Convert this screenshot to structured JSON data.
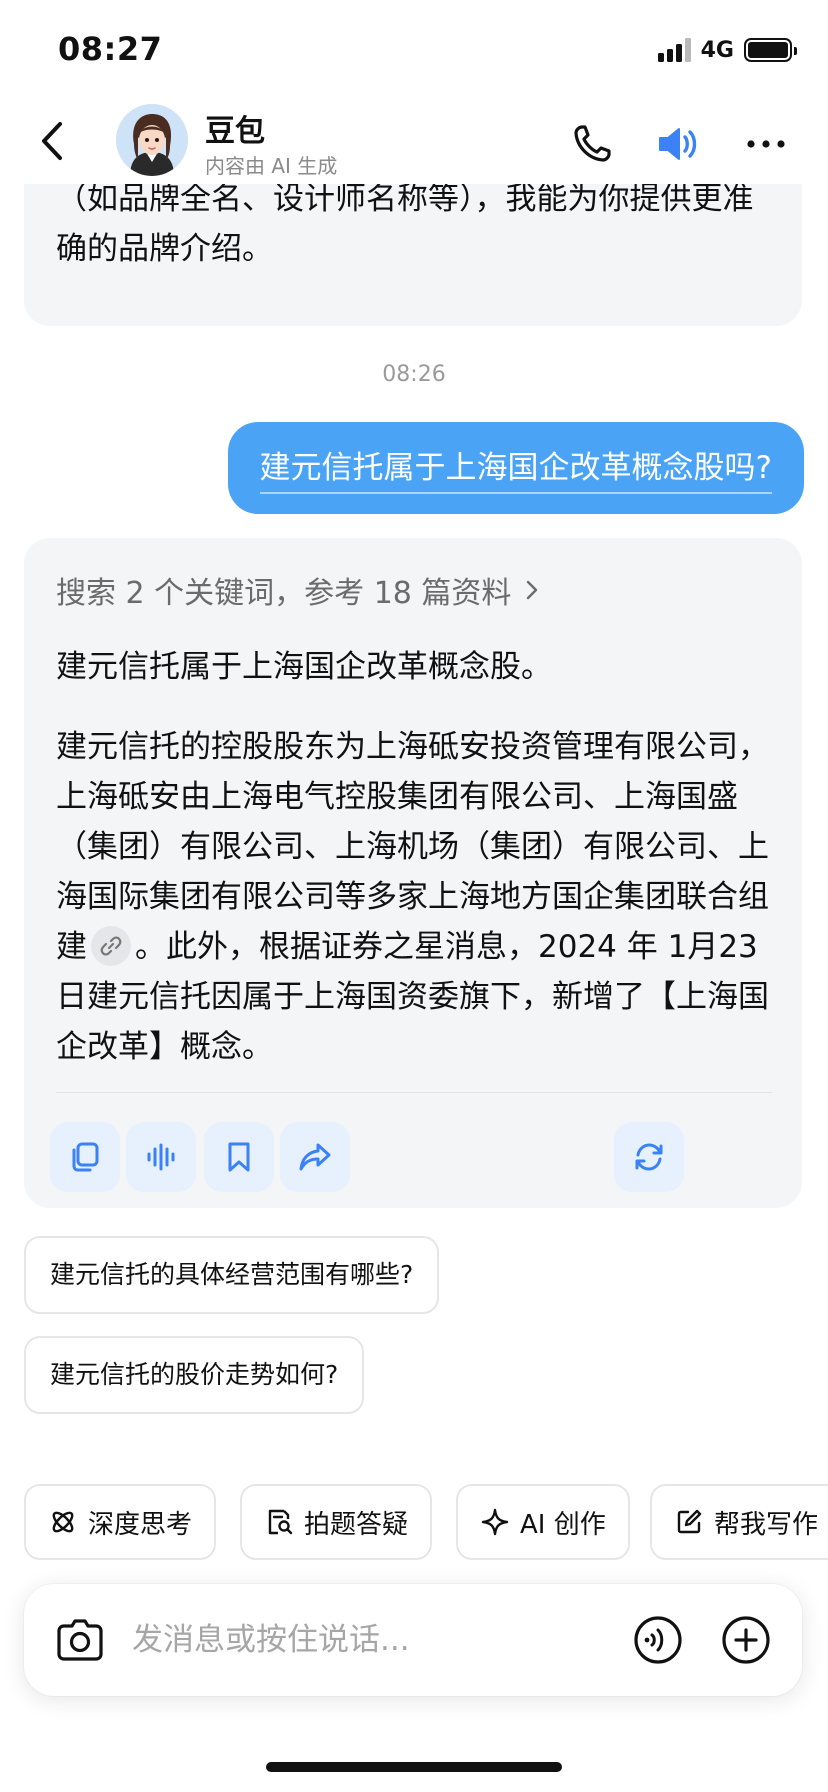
{
  "status": {
    "time": "08:27",
    "network": "4G"
  },
  "header": {
    "name": "豆包",
    "subtitle": "内容由 AI 生成"
  },
  "messages": {
    "prev_ai_text": "如果你想了解具体的皮鞋品牌，可以提供更多信息（如品牌全名、设计师名称等），我能为你提供更准确的品牌介绍。",
    "timestamp": "08:26",
    "user_question": "建元信托属于上海国企改革概念股吗?",
    "search_summary": "搜索 2 个关键词，参考 18 篇资料",
    "answer_p1": "建元信托属于上海国企改革概念股。",
    "answer_p2_a": "建元信托的控股股东为上海砥安投资管理有限公司，上海砥安由上海电气控股集团有限公司、上海国盛（集团）有限公司、上海机场（集团）有限公司、上海国际集团有限公司等多家上海地方国企集团联合组建",
    "answer_p2_b": "。此外，根据证券之星消息，2024 年 1月23日建元信托因属于上海国资委旗下，新增了【上海国企改革】概念。"
  },
  "suggestions": [
    "建元信托的具体经营范围有哪些?",
    "建元信托的股价走势如何?"
  ],
  "tools": [
    "深度思考",
    "拍题答疑",
    "AI 创作",
    "帮我写作"
  ],
  "composer": {
    "placeholder": "发消息或按住说话..."
  },
  "colors": {
    "accent": "#4ba3f5",
    "icon_blue": "#3b82f6",
    "card_bg": "#f4f5f7"
  },
  "icons": [
    "back-icon",
    "phone-icon",
    "speaker-icon",
    "more-icon",
    "link-icon",
    "copy-icon",
    "voice-wave-icon",
    "bookmark-icon",
    "share-icon",
    "refresh-icon",
    "camera-icon",
    "voice-call-icon",
    "plus-icon"
  ]
}
